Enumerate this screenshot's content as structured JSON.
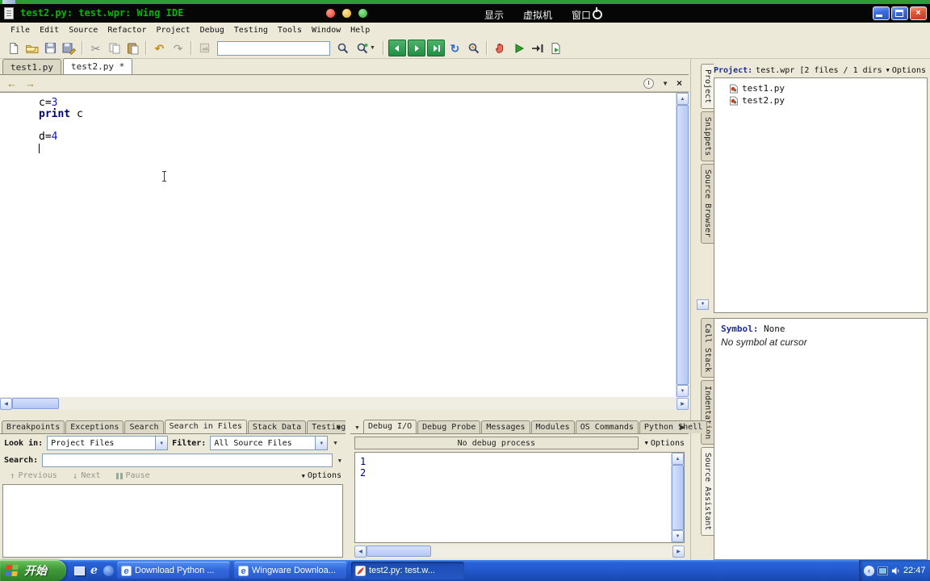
{
  "colors": {
    "keyword": "#00007f",
    "number": "#1414c8",
    "output": "#000080",
    "vm-title": "#00b800",
    "taskbar-blue": "#2a64d8",
    "start-green": "#3f9a37",
    "desktop-green": "#2d9b35"
  },
  "vm_bar": {
    "title": "test2.py: test.wpr: Wing IDE",
    "menus": [
      "显示",
      "虚拟机",
      "窗口"
    ]
  },
  "ide": {
    "menubar": [
      "File",
      "Edit",
      "Source",
      "Refactor",
      "Project",
      "Debug",
      "Testing",
      "Tools",
      "Window",
      "Help"
    ],
    "toolbar": {
      "search_value": "",
      "icons": [
        "new-file",
        "open-file",
        "save",
        "save-all",
        "cut",
        "copy",
        "paste",
        "undo",
        "redo",
        "toolbar-misc",
        "search-field",
        "find",
        "find-in-files",
        "nav-first",
        "nav-next",
        "nav-last",
        "refresh",
        "inspect",
        "break",
        "start-debug",
        "run-to-cursor",
        "debug-file"
      ]
    },
    "editor": {
      "tabs": [
        {
          "label": "test1.py",
          "active": false
        },
        {
          "label": "test2.py *",
          "active": true
        }
      ],
      "code_lines": [
        {
          "tokens": [
            {
              "text": "c=",
              "style": "plain"
            },
            {
              "text": "3",
              "style": "number"
            }
          ]
        },
        {
          "tokens": [
            {
              "text": "print",
              "style": "keyword"
            },
            {
              "text": " c",
              "style": "plain"
            }
          ]
        },
        {
          "tokens": []
        },
        {
          "tokens": [
            {
              "text": "d=",
              "style": "plain"
            },
            {
              "text": "4",
              "style": "number"
            }
          ]
        },
        {
          "tokens": [],
          "cursor": true
        }
      ]
    },
    "right_panel": {
      "top_tabs": [
        {
          "label": "Project",
          "active": true
        },
        {
          "label": "Snippets",
          "active": false
        },
        {
          "label": "Source Browser",
          "active": false
        }
      ],
      "bottom_tabs": [
        {
          "label": "Call Stack",
          "active": false
        },
        {
          "label": "Ind­entation",
          "active": false
        },
        {
          "label": "Source Assistant",
          "active": true
        }
      ],
      "project": {
        "title_label": "Project:",
        "title_value": "test.wpr [2 files / 1 dirs",
        "options_label": "Options",
        "files": [
          "test1.py",
          "test2.py"
        ]
      },
      "symbol": {
        "label": "Symbol:",
        "value": "None",
        "note": "No symbol at cursor"
      }
    },
    "bottom_left": {
      "tabs": [
        {
          "label": "Breakpoints",
          "active": false
        },
        {
          "label": "Exceptions",
          "active": false
        },
        {
          "label": "Search",
          "active": false
        },
        {
          "label": "Search in Files",
          "active": true
        },
        {
          "label": "Stack Data",
          "active": false
        },
        {
          "label": "Testing",
          "active": false
        }
      ],
      "look_in_label": "Look in:",
      "look_in_value": "Project Files",
      "filter_label": "Filter:",
      "filter_value": "All Source Files",
      "search_label": "Search:",
      "search_value": "",
      "prev_label": "Previous",
      "next_label": "Next",
      "pause_label": "Pause",
      "options_label": "Options"
    },
    "bottom_right": {
      "tabs": [
        {
          "label": "Debug I/O",
          "active": true
        },
        {
          "label": "Debug Probe",
          "active": false
        },
        {
          "label": "Messages",
          "active": false
        },
        {
          "label": "Modules",
          "active": false
        },
        {
          "label": "OS Commands",
          "active": false
        },
        {
          "label": "Python Shell",
          "active": false
        }
      ],
      "status": "No debug process",
      "options_label": "Options",
      "output_lines": [
        "1",
        "2"
      ]
    }
  },
  "taskbar": {
    "start_label": "开始",
    "tasks": [
      {
        "label": "Download Python ...",
        "icon": "ie",
        "active": false
      },
      {
        "label": "Wingware Downloa...",
        "icon": "ie",
        "active": false
      },
      {
        "label": "test2.py: test.w...",
        "icon": "wing",
        "active": true
      }
    ],
    "clock": "22:47"
  }
}
